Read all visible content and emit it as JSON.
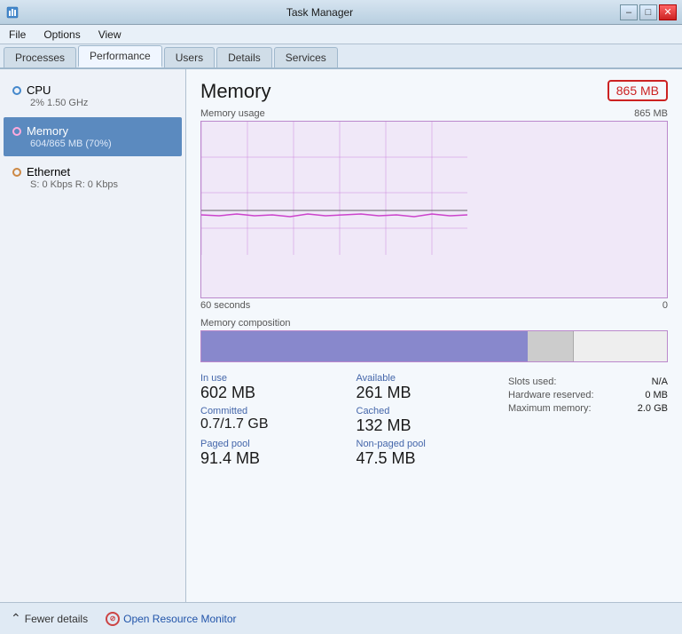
{
  "window": {
    "title": "Task Manager",
    "min_btn": "–",
    "max_btn": "□",
    "close_btn": "✕"
  },
  "menu": {
    "items": [
      "File",
      "Options",
      "View"
    ]
  },
  "tabs": [
    {
      "label": "Processes",
      "active": false
    },
    {
      "label": "Performance",
      "active": true
    },
    {
      "label": "Users",
      "active": false
    },
    {
      "label": "Details",
      "active": false
    },
    {
      "label": "Services",
      "active": false
    }
  ],
  "sidebar": {
    "items": [
      {
        "name": "CPU",
        "sub": "2% 1.50 GHz",
        "dot": "blue",
        "active": false
      },
      {
        "name": "Memory",
        "sub": "604/865 MB (70%)",
        "dot": "pink",
        "active": true
      },
      {
        "name": "Ethernet",
        "sub": "S: 0 Kbps  R: 0 Kbps",
        "dot": "orange",
        "active": false
      }
    ]
  },
  "memory": {
    "title": "Memory",
    "badge": "865 MB",
    "chart": {
      "usage_label": "Memory usage",
      "usage_max": "865 MB",
      "time_left": "60 seconds",
      "time_right": "0",
      "composition_label": "Memory composition"
    },
    "stats": {
      "in_use_label": "In use",
      "in_use_value": "602 MB",
      "available_label": "Available",
      "available_value": "261 MB",
      "committed_label": "Committed",
      "committed_value": "0.7/1.7 GB",
      "cached_label": "Cached",
      "cached_value": "132 MB",
      "paged_label": "Paged pool",
      "paged_value": "91.4 MB",
      "nonpaged_label": "Non-paged pool",
      "nonpaged_value": "47.5 MB",
      "slots_label": "Slots used:",
      "slots_value": "N/A",
      "hw_reserved_label": "Hardware reserved:",
      "hw_reserved_value": "0 MB",
      "max_mem_label": "Maximum memory:",
      "max_mem_value": "2.0 GB"
    }
  },
  "bottom": {
    "fewer_details": "Fewer details",
    "open_resource": "Open Resource Monitor"
  }
}
